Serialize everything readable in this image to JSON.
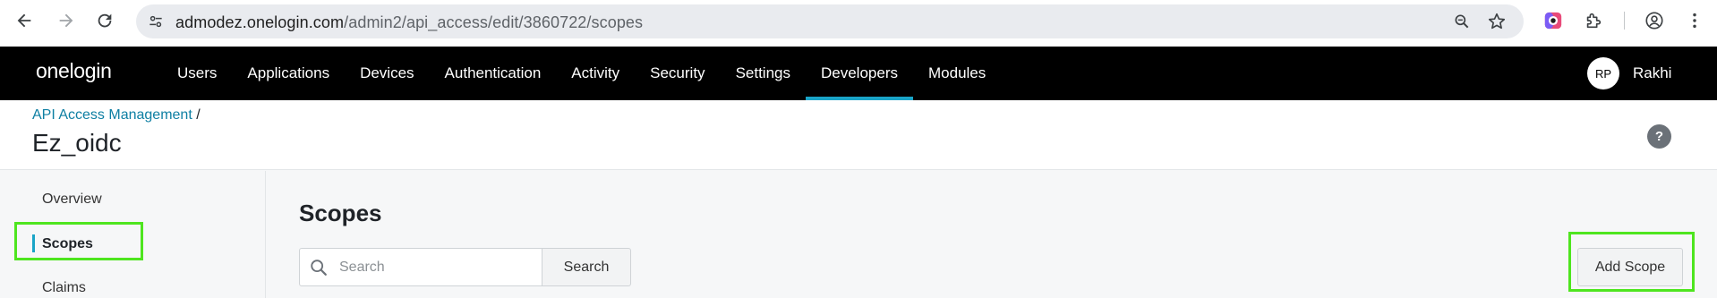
{
  "browser": {
    "url_host": "admodez.onelogin.com",
    "url_path": "/admin2/api_access/edit/3860722/scopes",
    "icons": [
      "back-icon",
      "forward-icon",
      "reload-icon",
      "site-info-icon",
      "zoom-icon",
      "star-icon",
      "extension-color-icon",
      "puzzle-icon",
      "profile-icon",
      "more-icon"
    ]
  },
  "app": {
    "logo": "onelogin",
    "nav": [
      "Users",
      "Applications",
      "Devices",
      "Authentication",
      "Activity",
      "Security",
      "Settings",
      "Developers",
      "Modules"
    ],
    "active_nav": "Developers",
    "user_initials": "RP",
    "user_name": "Rakhi"
  },
  "header": {
    "breadcrumb_link": "API Access Management",
    "breadcrumb_sep": " /",
    "title": "Ez_oidc",
    "help": "?"
  },
  "sidebar": {
    "items": [
      "Overview",
      "Scopes",
      "Claims"
    ],
    "active": "Scopes"
  },
  "main": {
    "title": "Scopes",
    "search_placeholder": "Search",
    "search_button": "Search",
    "add_button": "Add Scope"
  },
  "colors": {
    "accent": "#1aa4c7",
    "highlight": "#4ee51f",
    "link": "#0e7fa3"
  }
}
